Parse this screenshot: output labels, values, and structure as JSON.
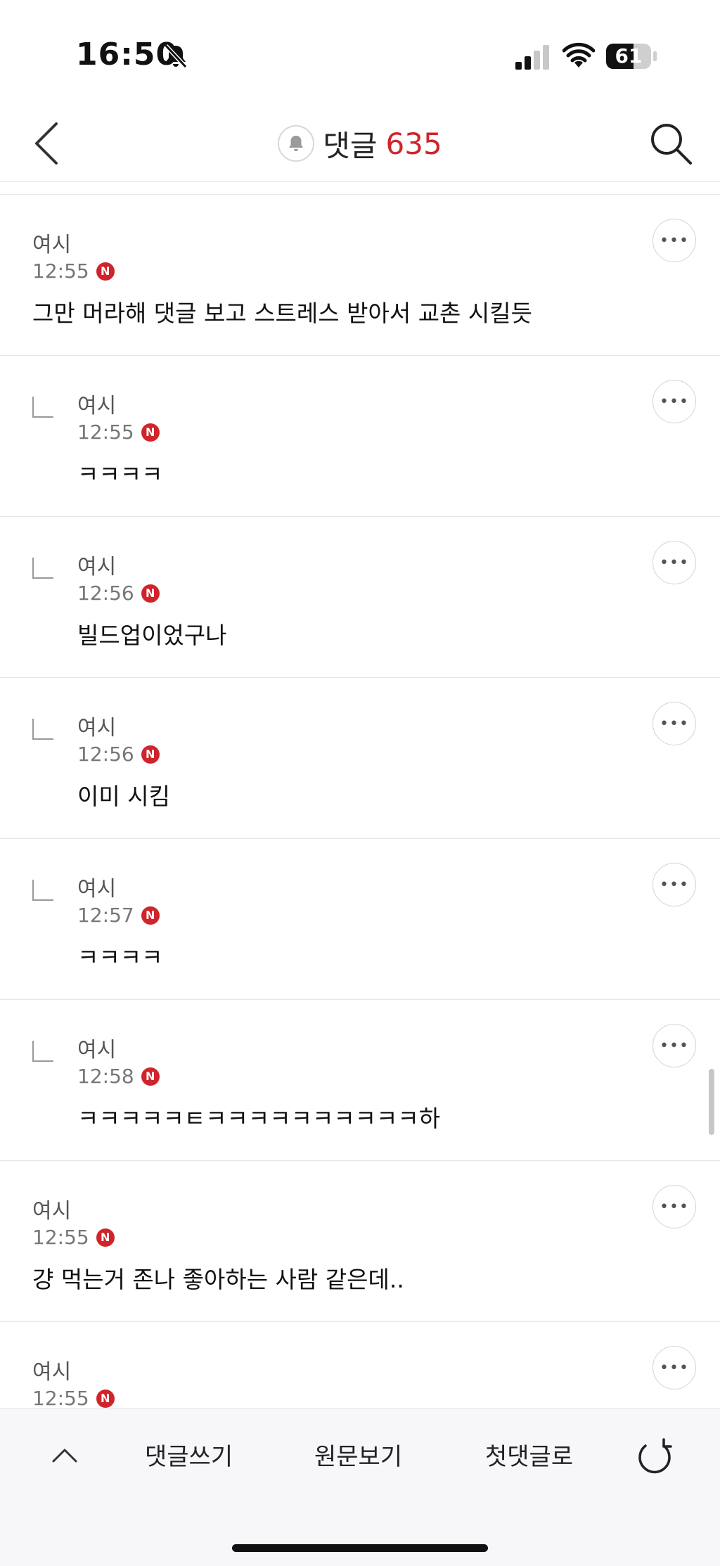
{
  "status_bar": {
    "time": "16:50",
    "battery": "61",
    "battery_level": 0.61
  },
  "header": {
    "title": "댓글",
    "count": "635"
  },
  "comments": [
    {
      "author": "여시",
      "time": "12:55",
      "badge": "N",
      "text": "그만 머라해 댓글 보고 스트레스 받아서 교촌 시킬듯",
      "reply": false
    },
    {
      "author": "여시",
      "time": "12:55",
      "badge": "N",
      "text": "ㅋㅋㅋㅋ",
      "reply": true
    },
    {
      "author": "여시",
      "time": "12:56",
      "badge": "N",
      "text": "빌드업이었구나",
      "reply": true
    },
    {
      "author": "여시",
      "time": "12:56",
      "badge": "N",
      "text": "이미 시킴",
      "reply": true
    },
    {
      "author": "여시",
      "time": "12:57",
      "badge": "N",
      "text": "ㅋㅋㅋㅋ",
      "reply": true
    },
    {
      "author": "여시",
      "time": "12:58",
      "badge": "N",
      "text": "ㅋㅋㅋㅋㅋㅌㅋㅋㅋㅋㅋㅋㅋㅋㅋㅋ하",
      "reply": true
    },
    {
      "author": "여시",
      "time": "12:55",
      "badge": "N",
      "text": "걍 먹는거 존나 좋아하는 사람 같은데..",
      "reply": false
    },
    {
      "author": "여시",
      "time": "12:55",
      "badge": "N",
      "text": "",
      "reply": false
    }
  ],
  "bottom_bar": {
    "write": "댓글쓰기",
    "original": "원문보기",
    "first": "첫댓글로"
  },
  "colors": {
    "accent": "#d0242b"
  }
}
